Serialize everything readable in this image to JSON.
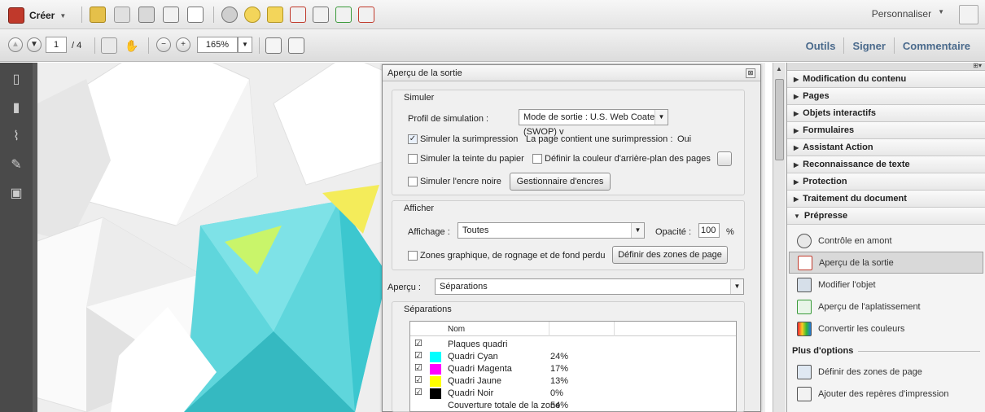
{
  "toolbar_top": {
    "create_label": "Créer",
    "customize_label": "Personnaliser"
  },
  "toolbar_nav": {
    "page_current": "1",
    "page_total": "/ 4",
    "zoom": "165%"
  },
  "tabs": [
    "Outils",
    "Signer",
    "Commentaire"
  ],
  "dialog": {
    "title": "Aperçu de la sortie",
    "simuler": {
      "label": "Simuler",
      "profile_label": "Profil de simulation :",
      "profile_value": "Mode de sortie : U.S. Web Coated (SWOP) v",
      "simulate_overprint": "Simuler la surimpression",
      "overprint_info_label": "La page contient une surimpression :",
      "overprint_info_value": "Oui",
      "simulate_paper": "Simuler la teinte du papier",
      "bg_color": "Définir la couleur d'arrière-plan des pages",
      "simulate_black": "Simuler l'encre noire",
      "ink_manager": "Gestionnaire d'encres"
    },
    "afficher": {
      "label": "Afficher",
      "affichage_label": "Affichage :",
      "affichage_value": "Toutes",
      "opacity_label": "Opacité :",
      "opacity_value": "100",
      "opacity_unit": "%",
      "zones_label": "Zones graphique, de rognage et de fond perdu",
      "zones_button": "Définir des zones de page"
    },
    "apercu_label": "Aperçu :",
    "apercu_value": "Séparations",
    "separations": {
      "label": "Séparations",
      "column_name": "Nom",
      "rows": [
        {
          "name": "Plaques quadri",
          "value": "",
          "color": ""
        },
        {
          "name": "Quadri Cyan",
          "value": "24%",
          "color": "#00ffff"
        },
        {
          "name": "Quadri Magenta",
          "value": "17%",
          "color": "#ff00ff"
        },
        {
          "name": "Quadri Jaune",
          "value": "13%",
          "color": "#ffff00"
        },
        {
          "name": "Quadri Noir",
          "value": "0%",
          "color": "#000000"
        },
        {
          "name": "Couverture totale de la zone",
          "value": "54%",
          "color": ""
        }
      ]
    }
  },
  "right_panel": {
    "sections": [
      "Modification du contenu",
      "Pages",
      "Objets interactifs",
      "Formulaires",
      "Assistant Action",
      "Reconnaissance de texte",
      "Protection",
      "Traitement du document",
      "Prépresse"
    ],
    "tools": [
      "Contrôle en amont",
      "Aperçu de la sortie",
      "Modifier l'objet",
      "Aperçu de l'aplatissement",
      "Convertir les couleurs"
    ],
    "more_options_label": "Plus d'options",
    "more_tools": [
      "Définir des zones de page",
      "Ajouter des repères d'impression"
    ]
  }
}
